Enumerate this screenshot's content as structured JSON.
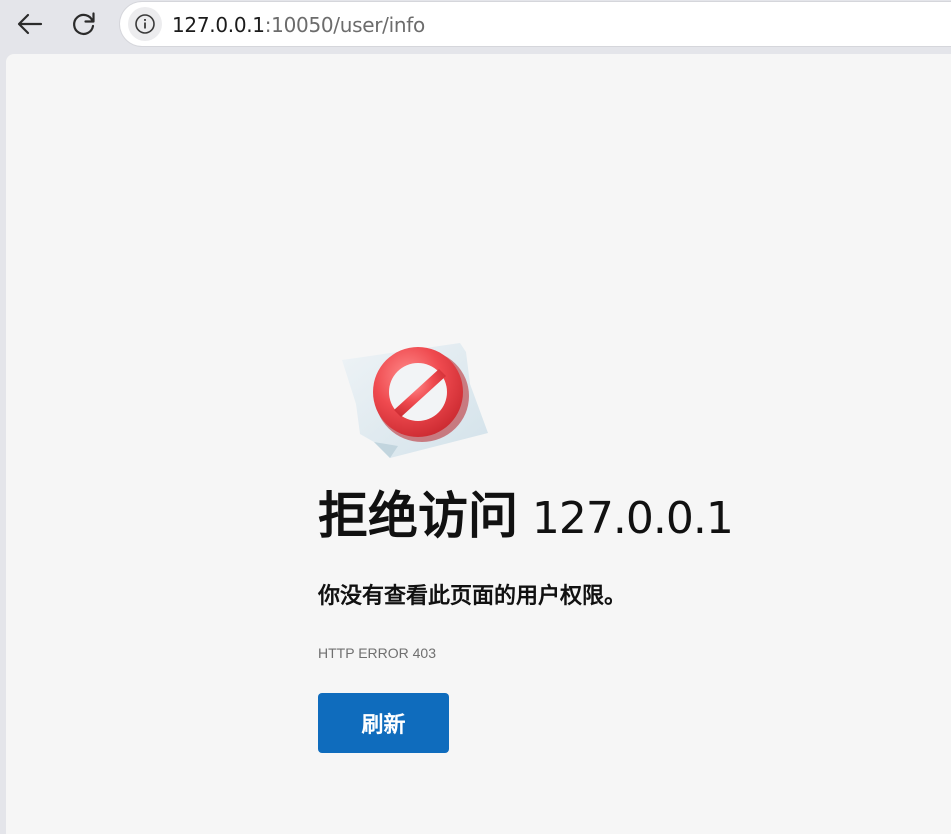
{
  "browser": {
    "url_host": "127.0.0.1",
    "url_rest": ":10050/user/info",
    "icons": {
      "back": "back-arrow-icon",
      "reload": "reload-icon",
      "site_info": "info-icon"
    }
  },
  "error_page": {
    "title_prefix": "拒绝访问",
    "title_host": "127.0.0.1",
    "message": "你没有查看此页面的用户权限。",
    "error_code": "HTTP ERROR 403",
    "refresh_label": "刷新",
    "illustration_icon": "blocked-sign-icon"
  },
  "colors": {
    "toolbar_bg": "#e4e5ea",
    "page_bg": "#f6f6f6",
    "button_primary": "#0f6cbd",
    "blocked_red": "#ef4a4f"
  }
}
